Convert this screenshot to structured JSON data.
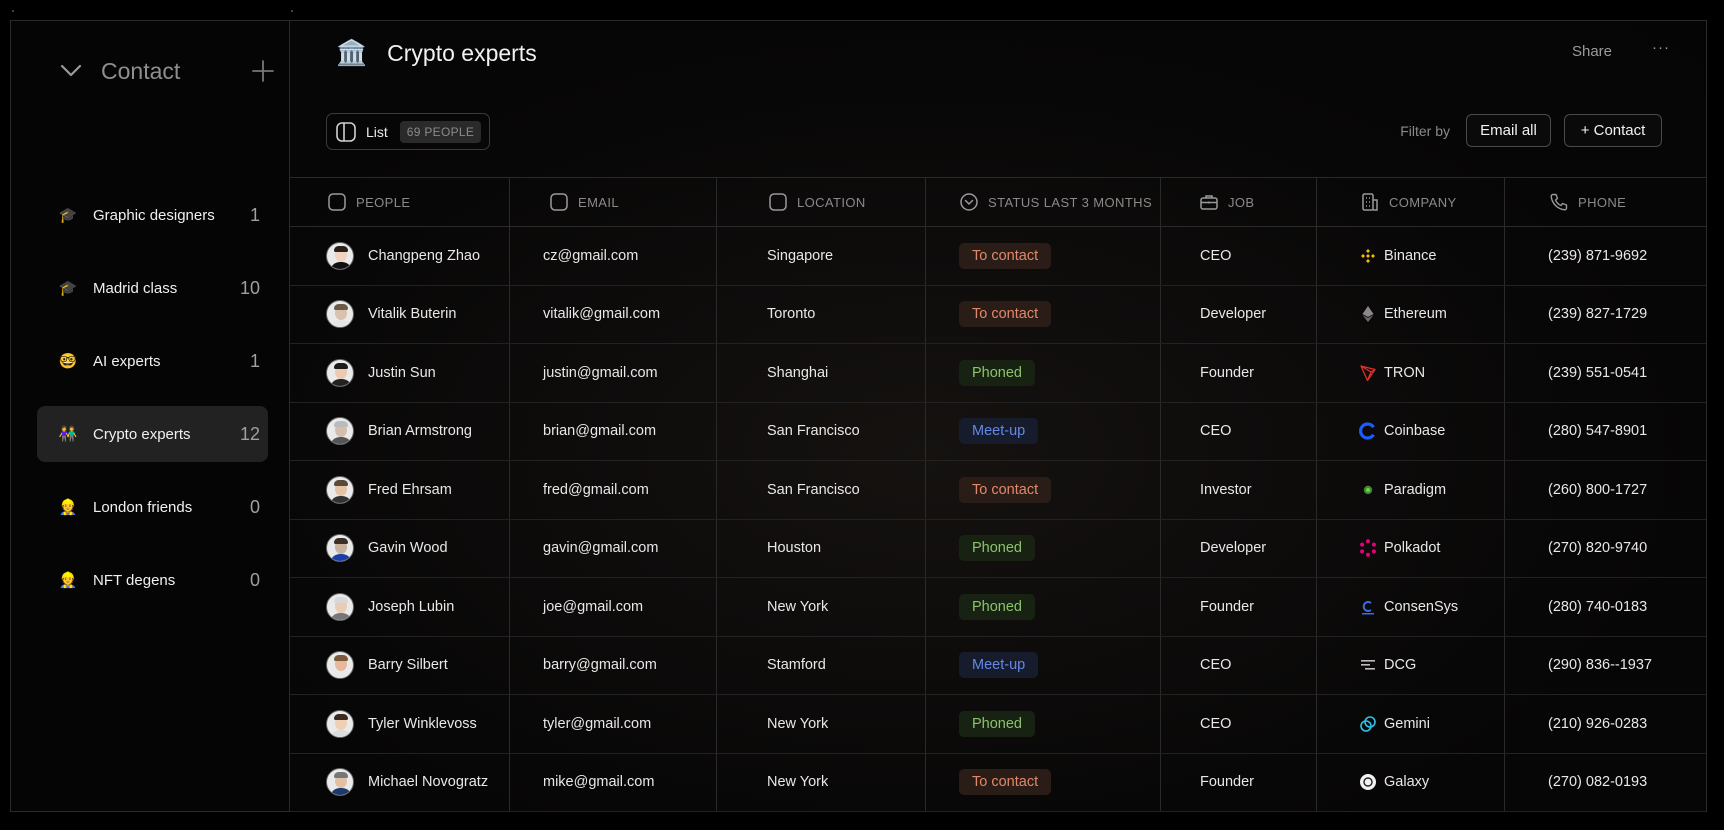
{
  "sidebar": {
    "title": "Contact",
    "items": [
      {
        "emoji": "🎓",
        "label": "Graphic designers",
        "count": "1",
        "active": false
      },
      {
        "emoji": "🎓",
        "label": "Madrid class",
        "count": "10",
        "active": false
      },
      {
        "emoji": "🤓",
        "label": "AI experts",
        "count": "1",
        "active": false
      },
      {
        "emoji": "👫",
        "label": "Crypto experts",
        "count": "12",
        "active": true
      },
      {
        "emoji": "👷",
        "label": "London friends",
        "count": "0",
        "active": false
      },
      {
        "emoji": "👷",
        "label": "NFT degens",
        "count": "0",
        "active": false
      }
    ]
  },
  "header": {
    "emoji": "🏛️",
    "title": "Crypto experts",
    "share_label": "Share",
    "more_label": "···"
  },
  "toolbar": {
    "view_label": "List",
    "people_badge": "69 PEOPLE",
    "filter_label": "Filter by",
    "email_all_label": "Email all",
    "add_contact_label": "+ Contact"
  },
  "table": {
    "columns": [
      {
        "key": "people",
        "label": "PEOPLE",
        "icon": "checkbox-icon"
      },
      {
        "key": "email",
        "label": "EMAIL",
        "icon": "checkbox-icon"
      },
      {
        "key": "location",
        "label": "LOCATION",
        "icon": "checkbox-icon"
      },
      {
        "key": "status",
        "label": "STATUS LAST 3 MONTHS",
        "icon": "chevron-circle-icon"
      },
      {
        "key": "job",
        "label": "JOB",
        "icon": "briefcase-icon"
      },
      {
        "key": "company",
        "label": "COMPANY",
        "icon": "building-icon"
      },
      {
        "key": "phone",
        "label": "PHONE",
        "icon": "phone-icon"
      }
    ],
    "rows": [
      {
        "name": "Changpeng Zhao",
        "email": "cz@gmail.com",
        "location": "Singapore",
        "status": "To contact",
        "job": "CEO",
        "company": "Binance",
        "company_logo": "binance-logo-icon",
        "phone": "(239) 871-9692"
      },
      {
        "name": "Vitalik Buterin",
        "email": "vitalik@gmail.com",
        "location": "Toronto",
        "status": "To contact",
        "job": "Developer",
        "company": "Ethereum",
        "company_logo": "ethereum-logo-icon",
        "phone": "(239) 827-1729"
      },
      {
        "name": "Justin Sun",
        "email": "justin@gmail.com",
        "location": "Shanghai",
        "status": "Phoned",
        "job": "Founder",
        "company": "TRON",
        "company_logo": "tron-logo-icon",
        "phone": "(239) 551-0541"
      },
      {
        "name": "Brian Armstrong",
        "email": "brian@gmail.com",
        "location": "San Francisco",
        "status": "Meet-up",
        "job": "CEO",
        "company": "Coinbase",
        "company_logo": "coinbase-logo-icon",
        "phone": "(280) 547-8901"
      },
      {
        "name": "Fred Ehrsam",
        "email": "fred@gmail.com",
        "location": "San Francisco",
        "status": "To contact",
        "job": "Investor",
        "company": "Paradigm",
        "company_logo": "paradigm-logo-icon",
        "phone": "(260) 800-1727"
      },
      {
        "name": "Gavin Wood",
        "email": "gavin@gmail.com",
        "location": "Houston",
        "status": "Phoned",
        "job": "Developer",
        "company": "Polkadot",
        "company_logo": "polkadot-logo-icon",
        "phone": "(270) 820-9740"
      },
      {
        "name": "Joseph Lubin",
        "email": "joe@gmail.com",
        "location": "New York",
        "status": "Phoned",
        "job": "Founder",
        "company": "ConsenSys",
        "company_logo": "consensys-logo-icon",
        "phone": "(280) 740-0183"
      },
      {
        "name": "Barry Silbert",
        "email": "barry@gmail.com",
        "location": "Stamford",
        "status": "Meet-up",
        "job": "CEO",
        "company": "DCG",
        "company_logo": "dcg-logo-icon",
        "phone": "(290) 836--1937"
      },
      {
        "name": "Tyler Winklevoss",
        "email": "tyler@gmail.com",
        "location": "New York",
        "status": "Phoned",
        "job": "CEO",
        "company": "Gemini",
        "company_logo": "gemini-logo-icon",
        "phone": "(210) 926-0283"
      },
      {
        "name": "Michael Novogratz",
        "email": "mike@gmail.com",
        "location": "New York",
        "status": "To contact",
        "job": "Founder",
        "company": "Galaxy",
        "company_logo": "galaxy-logo-icon",
        "phone": "(270) 082-0193"
      }
    ]
  },
  "colors": {
    "background": "#050505",
    "status_to_contact": "#e0896a",
    "status_phoned": "#8bc36a",
    "status_meet_up": "#6388e8"
  }
}
